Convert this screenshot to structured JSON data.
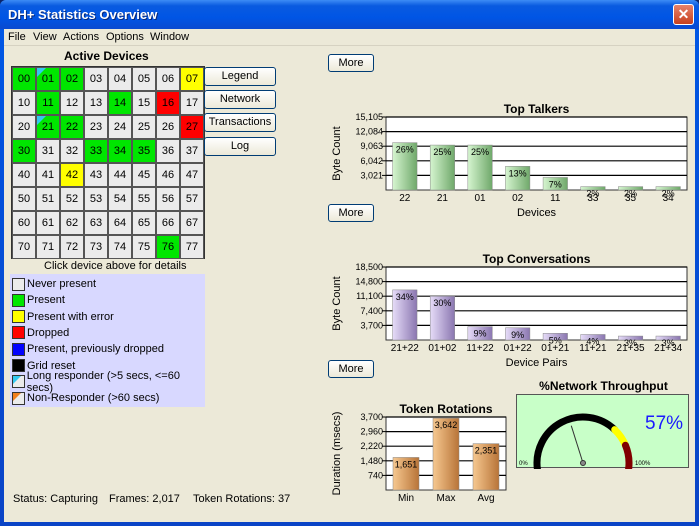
{
  "window": {
    "title": "DH+ Statistics Overview",
    "close_icon": "close-icon"
  },
  "menu": [
    "File",
    "View",
    "Actions",
    "Options",
    "Window"
  ],
  "active_devices": {
    "title": "Active Devices",
    "caption": "Click device above for details",
    "cells": [
      {
        "id": "00",
        "state": "present"
      },
      {
        "id": "01",
        "state": "present",
        "long": true
      },
      {
        "id": "02",
        "state": "present"
      },
      {
        "id": "03",
        "state": "never"
      },
      {
        "id": "04",
        "state": "never"
      },
      {
        "id": "05",
        "state": "never"
      },
      {
        "id": "06",
        "state": "never"
      },
      {
        "id": "07",
        "state": "error"
      },
      {
        "id": "10",
        "state": "never"
      },
      {
        "id": "11",
        "state": "present"
      },
      {
        "id": "12",
        "state": "never"
      },
      {
        "id": "13",
        "state": "never"
      },
      {
        "id": "14",
        "state": "present"
      },
      {
        "id": "15",
        "state": "never"
      },
      {
        "id": "16",
        "state": "dropped"
      },
      {
        "id": "17",
        "state": "never"
      },
      {
        "id": "20",
        "state": "never"
      },
      {
        "id": "21",
        "state": "present",
        "long": true
      },
      {
        "id": "22",
        "state": "present"
      },
      {
        "id": "23",
        "state": "never"
      },
      {
        "id": "24",
        "state": "never"
      },
      {
        "id": "25",
        "state": "never"
      },
      {
        "id": "26",
        "state": "never"
      },
      {
        "id": "27",
        "state": "dropped"
      },
      {
        "id": "30",
        "state": "present"
      },
      {
        "id": "31",
        "state": "never"
      },
      {
        "id": "32",
        "state": "never"
      },
      {
        "id": "33",
        "state": "present"
      },
      {
        "id": "34",
        "state": "present"
      },
      {
        "id": "35",
        "state": "present"
      },
      {
        "id": "36",
        "state": "never"
      },
      {
        "id": "37",
        "state": "never"
      },
      {
        "id": "40",
        "state": "never"
      },
      {
        "id": "41",
        "state": "never"
      },
      {
        "id": "42",
        "state": "error"
      },
      {
        "id": "43",
        "state": "never"
      },
      {
        "id": "44",
        "state": "never"
      },
      {
        "id": "45",
        "state": "never"
      },
      {
        "id": "46",
        "state": "never"
      },
      {
        "id": "47",
        "state": "never"
      },
      {
        "id": "50",
        "state": "never"
      },
      {
        "id": "51",
        "state": "never"
      },
      {
        "id": "52",
        "state": "never"
      },
      {
        "id": "53",
        "state": "never"
      },
      {
        "id": "54",
        "state": "never"
      },
      {
        "id": "55",
        "state": "never"
      },
      {
        "id": "56",
        "state": "never"
      },
      {
        "id": "57",
        "state": "never"
      },
      {
        "id": "60",
        "state": "never"
      },
      {
        "id": "61",
        "state": "never"
      },
      {
        "id": "62",
        "state": "never"
      },
      {
        "id": "63",
        "state": "never"
      },
      {
        "id": "64",
        "state": "never"
      },
      {
        "id": "65",
        "state": "never"
      },
      {
        "id": "66",
        "state": "never"
      },
      {
        "id": "67",
        "state": "never"
      },
      {
        "id": "70",
        "state": "never"
      },
      {
        "id": "71",
        "state": "never"
      },
      {
        "id": "72",
        "state": "never"
      },
      {
        "id": "73",
        "state": "never"
      },
      {
        "id": "74",
        "state": "never"
      },
      {
        "id": "75",
        "state": "never"
      },
      {
        "id": "76",
        "state": "present"
      },
      {
        "id": "77",
        "state": "never"
      }
    ]
  },
  "side_buttons": [
    "Legend",
    "Network",
    "Transactions",
    "Log"
  ],
  "legend": [
    {
      "label": "Never present",
      "color": "#ebebeb"
    },
    {
      "label": "Present",
      "color": "#00e600"
    },
    {
      "label": "Present with error",
      "color": "#ffff00"
    },
    {
      "label": "Dropped",
      "color": "#ff0000"
    },
    {
      "label": "Present, previously dropped",
      "color": "#0000ff"
    },
    {
      "label": "Grid reset",
      "color": "#000000"
    },
    {
      "label": "Long responder (>5 secs, <=60 secs)",
      "color": "#ebebeb",
      "corner": "#33c8f0"
    },
    {
      "label": "Non-Responder (>60 secs)",
      "color": "#ebebeb",
      "corner": "#f08020"
    }
  ],
  "status": {
    "status": "Status: Capturing",
    "frames": "Frames: 2,017",
    "rotations": "Token Rotations: 37"
  },
  "more_label": "More",
  "chart_data": [
    {
      "type": "bar",
      "title": "Top Talkers",
      "xlabel": "Devices",
      "ylabel": "Byte Count",
      "ylim": [
        0,
        15105
      ],
      "yticks": [
        "3,021",
        "6,042",
        "9,063",
        "12,084",
        "15,105"
      ],
      "ytick_values": [
        3021,
        6042,
        9063,
        12084,
        15105
      ],
      "categories": [
        "22",
        "21",
        "01",
        "02",
        "11",
        "33",
        "35",
        "34"
      ],
      "values": [
        9800,
        9300,
        9300,
        4900,
        2600,
        700,
        700,
        700
      ],
      "labels": [
        "26%",
        "25%",
        "25%",
        "13%",
        "7%",
        "2%",
        "2%",
        "2%"
      ],
      "color": "green",
      "grid": true
    },
    {
      "type": "bar",
      "title": "Top Conversations",
      "xlabel": "Device Pairs",
      "ylabel": "Byte Count",
      "ylim": [
        0,
        18500
      ],
      "yticks": [
        "3,700",
        "7,400",
        "11,100",
        "14,800",
        "18,500"
      ],
      "ytick_values": [
        3700,
        7400,
        11100,
        14800,
        18500
      ],
      "categories": [
        "21+22",
        "01+02",
        "11+22",
        "01+22",
        "01+21",
        "11+21",
        "21+35",
        "21+34"
      ],
      "values": [
        12700,
        11100,
        3400,
        3100,
        1700,
        1400,
        1000,
        1000
      ],
      "labels": [
        "34%",
        "30%",
        "9%",
        "9%",
        "5%",
        "4%",
        "3%",
        "3%"
      ],
      "color": "purple",
      "grid": true
    },
    {
      "type": "bar",
      "title": "Token Rotations",
      "xlabel": "",
      "ylabel": "Duration (msecs)",
      "ylim": [
        0,
        3700
      ],
      "yticks": [
        "740",
        "1,480",
        "2,220",
        "2,960",
        "3,700"
      ],
      "ytick_values": [
        740,
        1480,
        2220,
        2960,
        3700
      ],
      "categories": [
        "Min",
        "Max",
        "Avg"
      ],
      "values": [
        1651,
        3642,
        2351
      ],
      "labels": [
        "1,651",
        "3,642",
        "2,351"
      ],
      "color": "orange",
      "grid": true
    }
  ],
  "gauge": {
    "title": "%Network Throughput",
    "value_label": "57%",
    "value": 57,
    "min_label": "0%",
    "max_label": "100%"
  }
}
